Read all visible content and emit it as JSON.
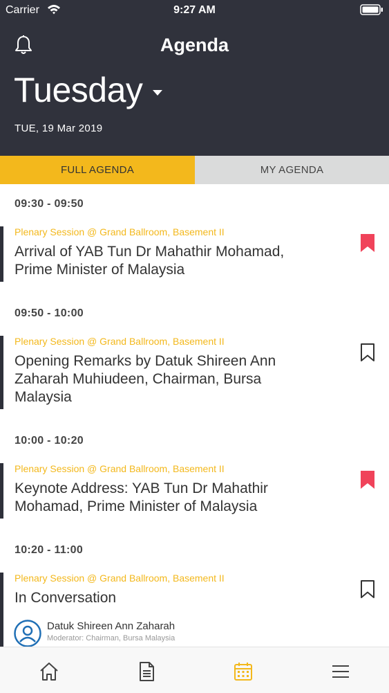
{
  "status_bar": {
    "carrier": "Carrier",
    "time": "9:27 AM"
  },
  "header": {
    "title": "Agenda",
    "day": "Tuesday",
    "date": "TUE, 19 Mar 2019"
  },
  "tabs": {
    "full_agenda": "FULL AGENDA",
    "my_agenda": "MY AGENDA",
    "active": "FULL AGENDA"
  },
  "sessions": [
    {
      "time": "09:30 - 09:50",
      "location": "Plenary Session @ Grand Ballroom, Basement II",
      "title": "Arrival of YAB Tun Dr Mahathir Mohamad, Prime Minister of Malaysia",
      "bookmarked": true
    },
    {
      "time": "09:50 - 10:00",
      "location": "Plenary Session @ Grand Ballroom, Basement II",
      "title": "Opening Remarks by Datuk Shireen Ann Zaharah Muhiudeen, Chairman, Bursa Malaysia",
      "bookmarked": false
    },
    {
      "time": "10:00 - 10:20",
      "location": "Plenary Session @ Grand Ballroom, Basement II",
      "title": "Keynote Address: YAB Tun Dr Mahathir Mohamad, Prime Minister of Malaysia",
      "bookmarked": true
    },
    {
      "time": "10:20 - 11:00",
      "location": "Plenary Session @ Grand Ballroom, Basement II",
      "title": "In Conversation",
      "bookmarked": false,
      "speaker": {
        "name": "Datuk Shireen Ann Zaharah",
        "role": "Moderator: Chairman, Bursa Malaysia"
      }
    }
  ],
  "bottom_nav": [
    {
      "icon": "home-icon",
      "active": false
    },
    {
      "icon": "document-icon",
      "active": false
    },
    {
      "icon": "calendar-icon",
      "active": true
    },
    {
      "icon": "menu-icon",
      "active": false
    }
  ],
  "colors": {
    "header_bg": "#30323c",
    "accent": "#f3b81c",
    "bookmark_active": "#f0435a",
    "tab_inactive_bg": "#dadbdb"
  }
}
